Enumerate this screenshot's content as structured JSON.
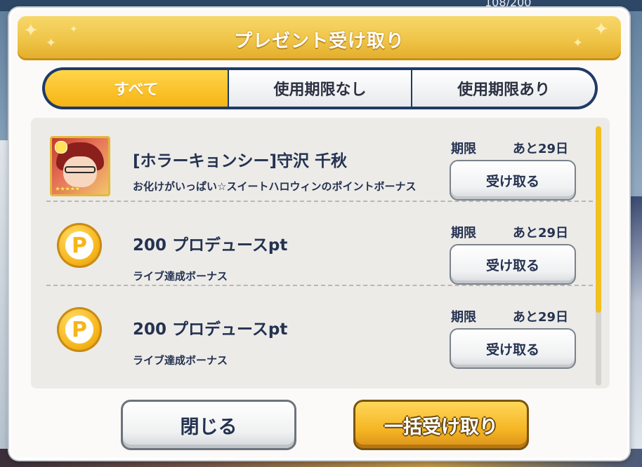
{
  "background": {
    "top_counter": "108/200"
  },
  "dialog": {
    "title": "プレゼント受け取り",
    "tabs": [
      {
        "label": "すべて",
        "selected": true
      },
      {
        "label": "使用期限なし",
        "selected": false
      },
      {
        "label": "使用期限あり",
        "selected": false
      }
    ],
    "items": [
      {
        "icon": "character-card-icon",
        "title": "[ホラーキョンシー]守沢 千秋",
        "description": "お化けがいっぱい☆スイートハロウィンのポイントボーナス",
        "limit_label": "期限",
        "limit_value": "あと29日",
        "button_label": "受け取る"
      },
      {
        "icon": "produce-point-coin-icon",
        "title": "200 プロデュースpt",
        "description": "ライブ達成ボーナス",
        "limit_label": "期限",
        "limit_value": "あと29日",
        "button_label": "受け取る"
      },
      {
        "icon": "produce-point-coin-icon",
        "title": "200 プロデュースpt",
        "description": "ライブ達成ボーナス",
        "limit_label": "期限",
        "limit_value": "あと29日",
        "button_label": "受け取る"
      }
    ],
    "coin_letter": "P",
    "close_label": "閉じる",
    "receive_all_label": "一括受け取り"
  },
  "colors": {
    "accent_gold": "#f5b623",
    "text_navy": "#243250",
    "tab_border": "#1f3a66"
  }
}
